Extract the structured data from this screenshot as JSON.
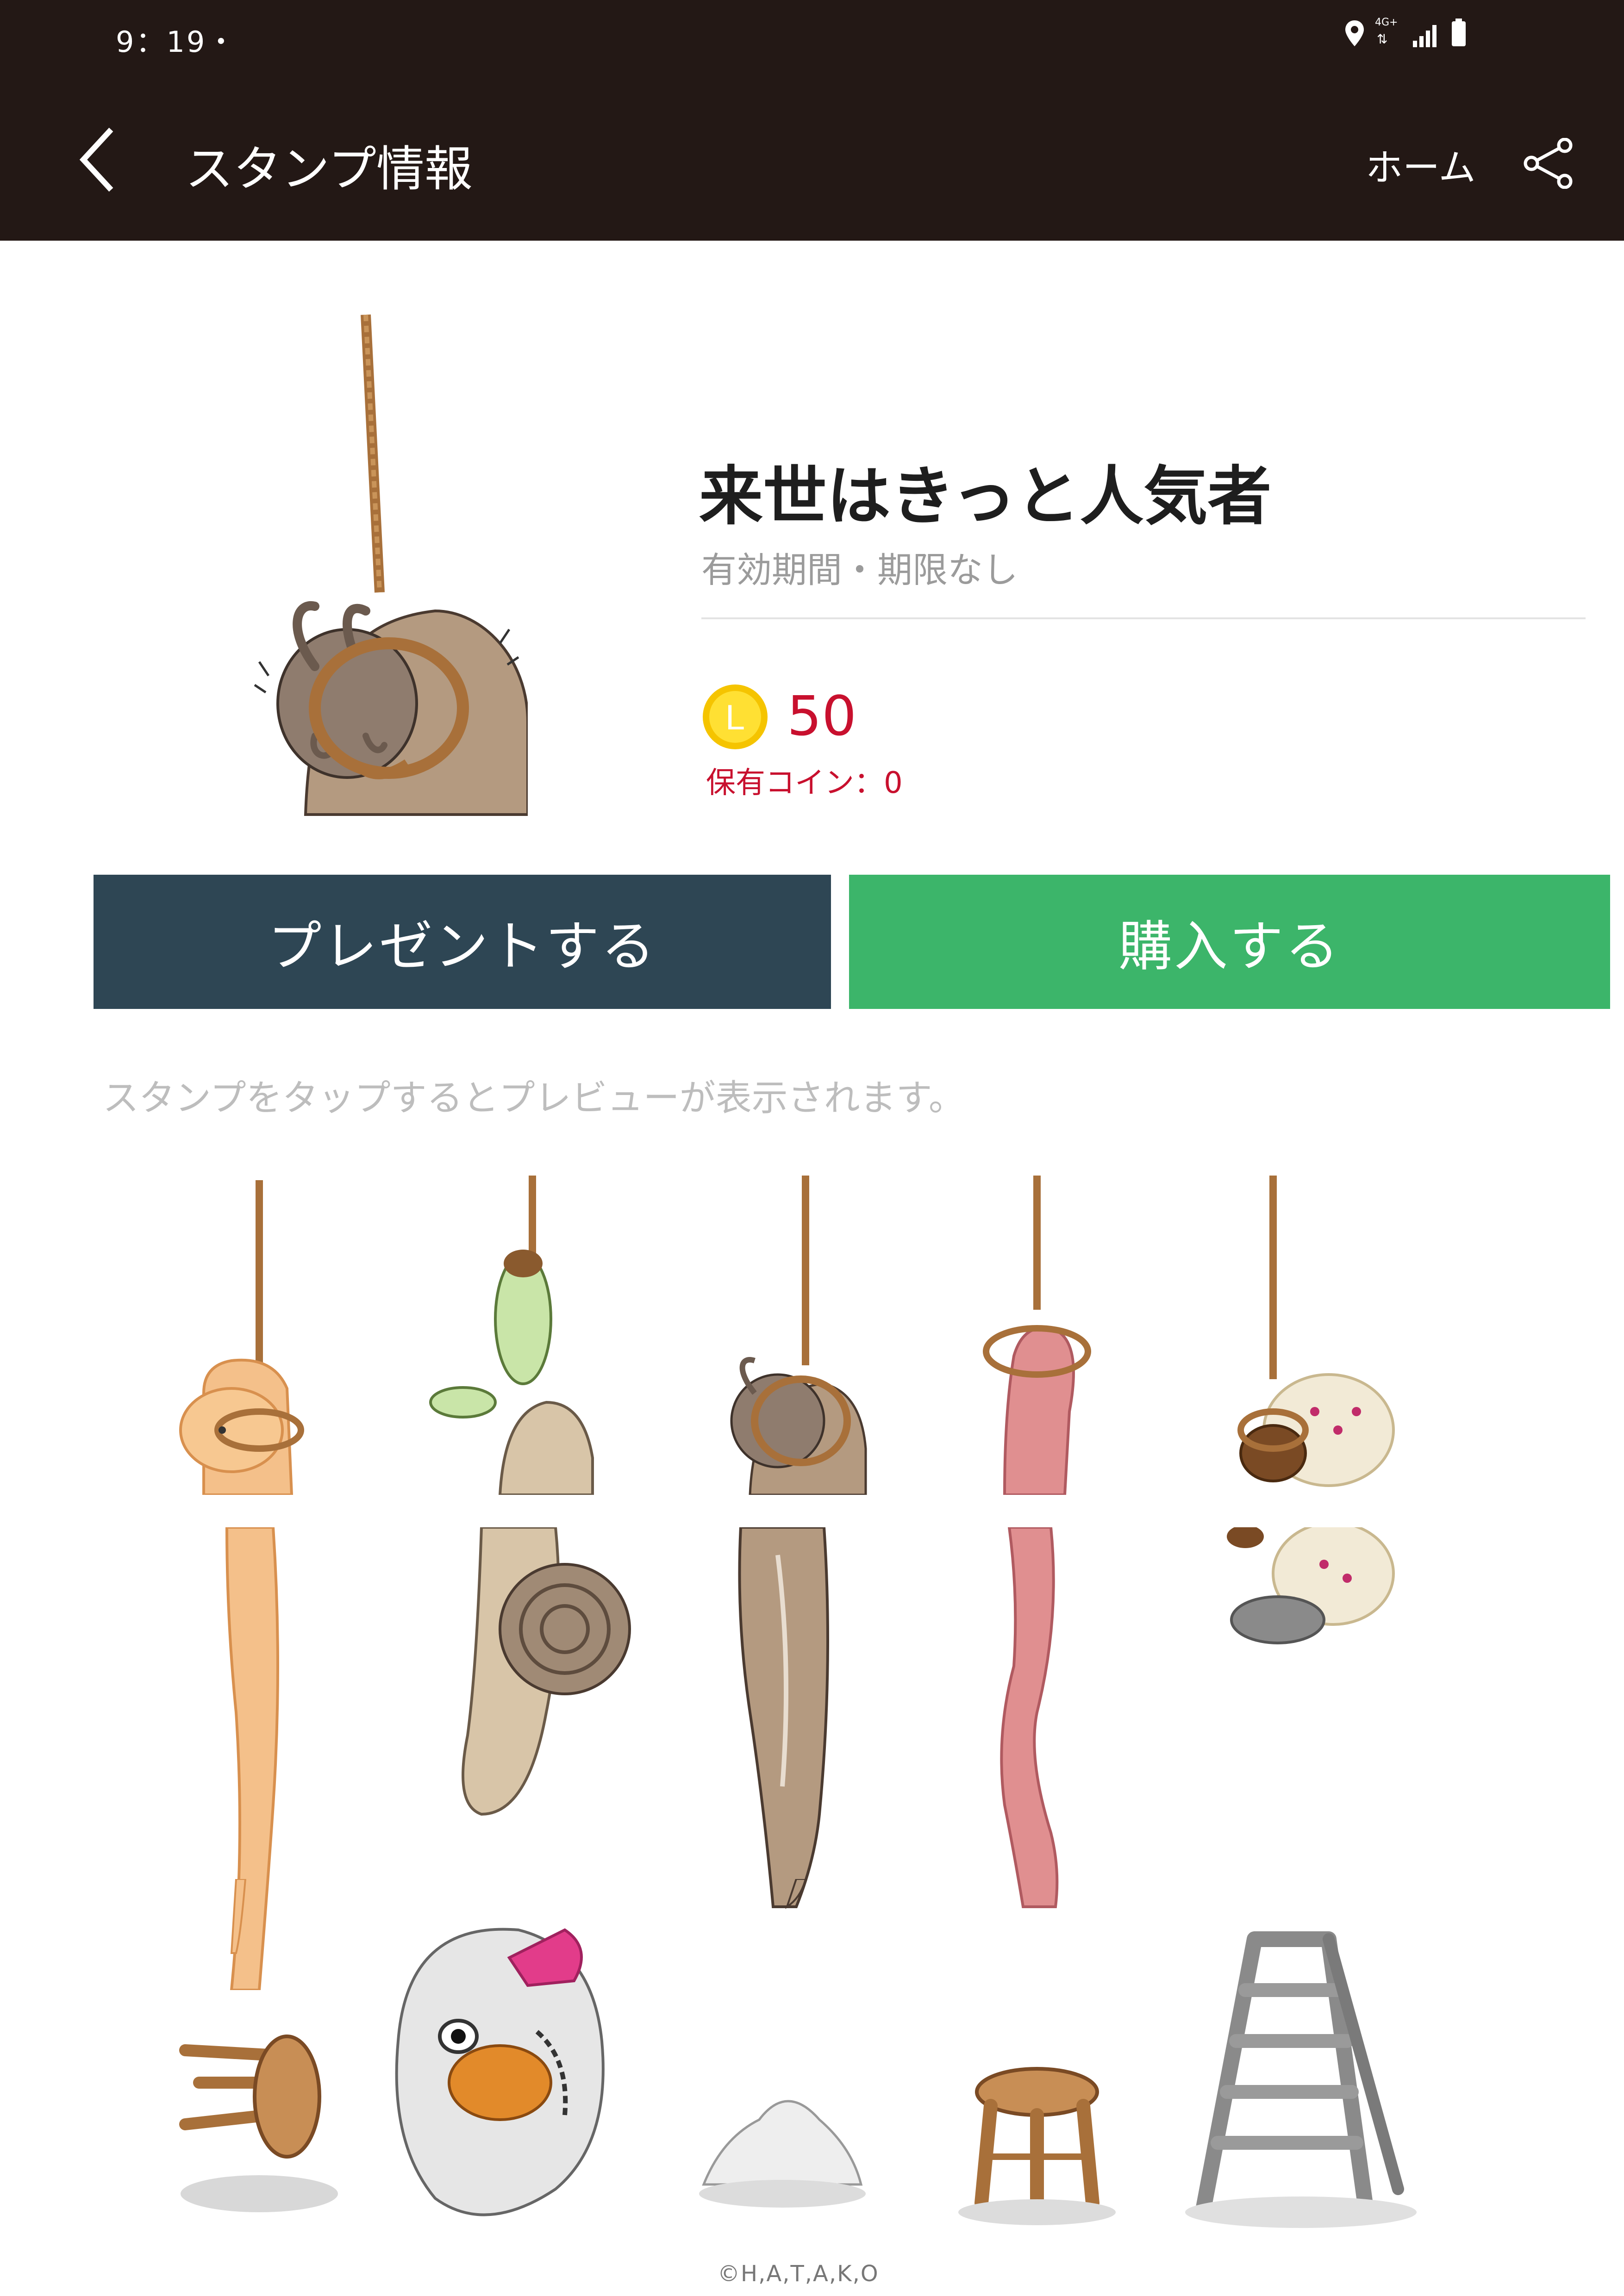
{
  "status_bar": {
    "time": "9：19・",
    "network": "4G+"
  },
  "app_bar": {
    "title": "スタンプ情報",
    "home": "ホーム"
  },
  "sticker": {
    "title": "来世はきっと人気者",
    "validity": "有効期間・期限なし",
    "coin_letter": "L",
    "price": "50",
    "coins_owned": "保有コイン：0"
  },
  "actions": {
    "gift": "プレゼントする",
    "buy": "購入する"
  },
  "hint": "スタンプをタップするとプレビューが表示されます。",
  "copyright": "©H,A,T,A,K,O",
  "colors": {
    "header": "#231815",
    "gift": "#2e4654",
    "buy": "#3cb56a",
    "price": "#c8102e"
  },
  "stickers": [
    {
      "name": "hanging-sweet-potato"
    },
    {
      "name": "hanging-snail-cocoon"
    },
    {
      "name": "hanging-slug"
    },
    {
      "name": "hanging-worm"
    },
    {
      "name": "hanging-creature-with-bowl"
    },
    {
      "name": "sweet-potato-body"
    },
    {
      "name": "snail-body"
    },
    {
      "name": "slug-body"
    },
    {
      "name": "worm-body"
    },
    {
      "name": "creature-bowl"
    },
    {
      "name": "toppled-stool"
    },
    {
      "name": "zebra-finch"
    },
    {
      "name": "dust-pile"
    },
    {
      "name": "wooden-stool"
    },
    {
      "name": "stepladder"
    }
  ]
}
